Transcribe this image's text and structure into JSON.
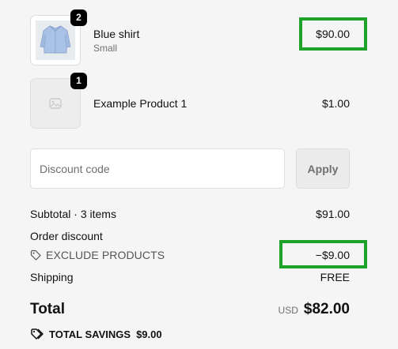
{
  "line_items": [
    {
      "title": "Blue shirt",
      "variant": "Small",
      "quantity": "2",
      "price": "$90.00",
      "image": "blue-shirt-photo"
    },
    {
      "title": "Example Product 1",
      "quantity": "1",
      "price": "$1.00",
      "image": "image-placeholder-icon"
    }
  ],
  "discount": {
    "placeholder": "Discount code",
    "apply_label": "Apply"
  },
  "summary": {
    "subtotal_label": "Subtotal · 3 items",
    "subtotal_value": "$91.00",
    "order_discount_label": "Order discount",
    "discount_code": "EXCLUDE PRODUCTS",
    "discount_value": "−$9.00",
    "shipping_label": "Shipping",
    "shipping_value": "FREE",
    "total_label": "Total",
    "currency": "USD",
    "total_value": "$82.00",
    "savings_label": "TOTAL SAVINGS",
    "savings_value": "$9.00"
  },
  "colors": {
    "highlight": "#1fa22a",
    "background": "#f5f5f5",
    "badge": "#000000"
  }
}
